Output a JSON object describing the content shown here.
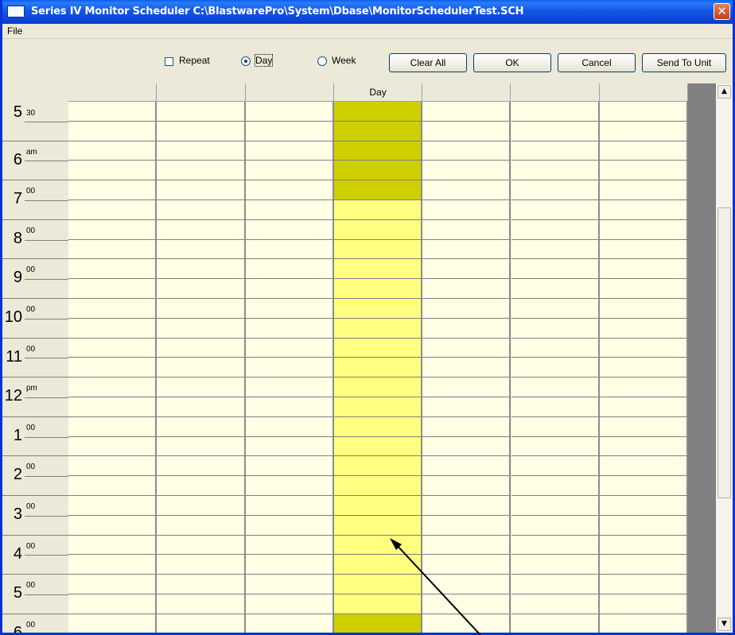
{
  "window": {
    "title": "Series IV Monitor Scheduler   C:\\BlastwarePro\\System\\Dbase\\MonitorSchedulerTest.SCH",
    "close_glyph": "✕"
  },
  "menu": {
    "file": "File"
  },
  "toolbar": {
    "repeat_label": "Repeat",
    "repeat_checked": false,
    "day_label": "Day",
    "week_label": "Week",
    "selected_mode": "Day",
    "clear_all": "Clear All",
    "ok": "OK",
    "cancel": "Cancel",
    "send_to_unit": "Send To Unit"
  },
  "schedule": {
    "columns": [
      "",
      "",
      "",
      "Day",
      "",
      "",
      ""
    ],
    "rows": [
      {
        "hour": "5",
        "sub": "30"
      },
      {
        "hour": "6",
        "sub": "am"
      },
      {
        "hour": "7",
        "sub": "00"
      },
      {
        "hour": "8",
        "sub": "00"
      },
      {
        "hour": "9",
        "sub": "00"
      },
      {
        "hour": "10",
        "sub": "00"
      },
      {
        "hour": "11",
        "sub": "00"
      },
      {
        "hour": "12",
        "sub": "pm"
      },
      {
        "hour": "1",
        "sub": "00"
      },
      {
        "hour": "2",
        "sub": "00"
      },
      {
        "hour": "3",
        "sub": "00"
      },
      {
        "hour": "4",
        "sub": "00"
      },
      {
        "hour": "5",
        "sub": "00"
      },
      {
        "hour": "6",
        "sub": "00"
      }
    ],
    "selected_column": 3,
    "highlight_colors": {
      "dark": "#cfcf00",
      "light": "#ffff80",
      "empty": "#ffffe6"
    },
    "dark_half_rows_column_3": [
      0,
      1,
      2,
      3,
      4,
      26,
      27
    ],
    "light_half_rows_column_3_from": 5,
    "light_half_rows_column_3_to": 25
  },
  "icons": {
    "app_icon": "window-icon",
    "close": "close-icon",
    "scroll_up": "chevron-up-icon",
    "scroll_down": "chevron-down-icon",
    "annotation": "arrow-icon"
  }
}
